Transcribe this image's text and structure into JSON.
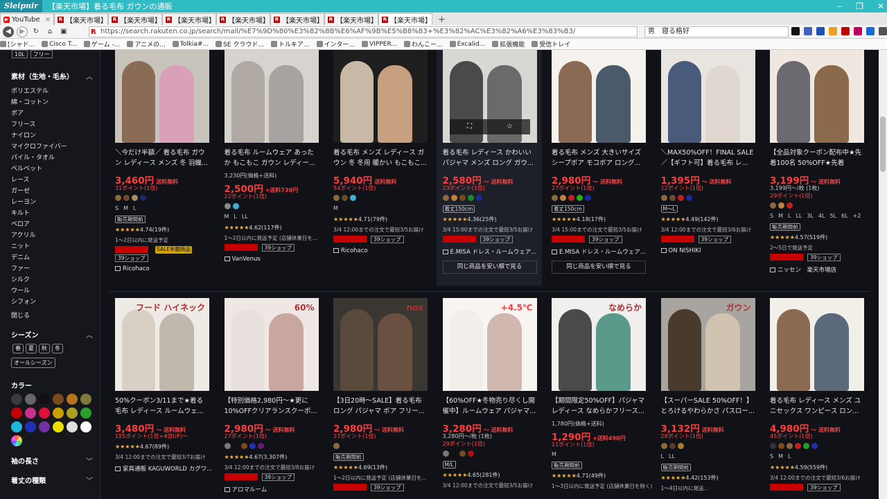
{
  "window": {
    "brand": "Sleipnir",
    "title": "【楽天市場】着る毛布 ガウンの通販",
    "controls": [
      "‒",
      "❐",
      "✕"
    ]
  },
  "tabs": [
    {
      "label": "YouTube",
      "fav": "yt"
    },
    {
      "label": "【楽天市場】着る...",
      "fav": "r"
    },
    {
      "label": "【楽天市場】着る...",
      "fav": "r"
    },
    {
      "label": "【楽天市場】着る...",
      "fav": "r"
    },
    {
      "label": "【楽天市場】着る...",
      "fav": "r"
    },
    {
      "label": "【楽天市場】[10...",
      "fav": "r"
    },
    {
      "label": "【楽天市場】[10...",
      "fav": "r"
    },
    {
      "label": "【楽天市場】着る...",
      "fav": "r",
      "active": true
    }
  ],
  "address": {
    "url": "https://search.rakuten.co.jp/search/mall/%E7%9D%80%E3%82%8B%E6%AF%9B%E5%B8%83+%E3%82%AC%E3%82%A6%E3%83%B3/",
    "search_value": "男　寝る格好"
  },
  "bookmarks": [
    "[シャド...",
    "Cisco T...",
    "ゲーム -...",
    "アニメの...",
    "Tolkia#...",
    "SE クラウド...",
    "トルキア...",
    "インター...",
    "VIPPER...",
    "わんこー...",
    "Excalid...",
    "拡張機能",
    "受信トレイ"
  ],
  "sidebar": {
    "sizes": [
      "10L",
      "フリー"
    ],
    "material_header": "素材（生地・毛糸）",
    "materials": [
      "ポリエステル",
      "綿・コットン",
      "ボア",
      "フリース",
      "ナイロン",
      "マイクロファイバー",
      "パイル・タオル",
      "ベルベット",
      "レース",
      "ガーゼ",
      "レーヨン",
      "キルト",
      "ベロア",
      "アクリル",
      "ニット",
      "デニム",
      "ファー",
      "シルク",
      "ウール",
      "シフォン"
    ],
    "close": "閉じる",
    "season_header": "シーズン",
    "seasons": [
      "春",
      "夏",
      "秋",
      "冬"
    ],
    "all_season": "オールシーズン",
    "color_header": "カラー",
    "colors": [
      "#3a3a3a",
      "#666666",
      "#111111",
      "#7a4a1a",
      "#b8741a",
      "#7d7a3a",
      "#c40000",
      "#c8308a",
      "#e0103a",
      "#c9a000",
      "#a8a020",
      "#2aa02a",
      "#1fb5d8",
      "#2030b0",
      "#7030a0",
      "#e8e000",
      "#e0e0e0",
      "#ffffff"
    ],
    "sleeve_header": "袖の長さ",
    "length_header": "着丈の種類"
  },
  "row1": [
    {
      "name": "＼今だけ半額／ 着る毛布 ガウン レディース メンズ 冬 羽織...",
      "price": "3,460円",
      "price_note": "送料無料",
      "points": "31ポイント(1倍)",
      "dots": [
        "#8a6a3a",
        "#6a4a2a",
        "#a09060",
        "#1a2a6a"
      ],
      "sizes": [
        "S",
        "M",
        "L"
      ],
      "tag": "販売期間前",
      "rating": "4.74",
      "reviews": "(19件)",
      "ship": "1〜2日以内に発送予定",
      "redtag": "SALE半額商品",
      "shop39": "39ショップ",
      "store": "Ricohaco"
    },
    {
      "name": "着る毛布 ルームウェア あったか もこもこ ガウン レディー...",
      "subprice": "3,230円(価格+送料)",
      "price": "2,500円",
      "price_note": "+送料730円",
      "points": "22ポイント(1倍)",
      "dots": [
        "#888888",
        "#40b0d0"
      ],
      "sizes": [
        "M",
        "L",
        "LL"
      ],
      "rating": "4.62",
      "reviews": "(117件)",
      "ship": "1〜2日以内に発送予定 (店舗休業日を...",
      "shop39": "39ショップ",
      "store": "VanVenus"
    },
    {
      "name": "着る毛布 メンズ レディース ガウン 冬 冬用 暖かい もこもこ...",
      "price": "5,940円",
      "price_note": "送料無料",
      "points": "54ポイント(1倍)",
      "dots": [
        "#8a6a3a",
        "#6a4a2a",
        "#40b0d0"
      ],
      "sizes": [
        "M"
      ],
      "rating": "4.71",
      "reviews": "(79件)",
      "ship": "3/4 12:00までの注文で最短3/5お届け",
      "shop39": "39ショップ",
      "store": "Ricohaco"
    },
    {
      "name": "着る毛布 レディース かわいい パジャマ メンズ ロング ガウ...",
      "price": "2,580円",
      "price_note": "〜 送料無料",
      "points": "23ポイント(1倍)",
      "dots": [
        "#8a6a3a",
        "#c08040",
        "#7a4a1a",
        "#1a8a2a",
        "#1a2a9a"
      ],
      "tag": "着丈150cm",
      "rating": "4.36",
      "reviews": "(25件)",
      "ship": "3/4 15:00までの注文で最短3/5お届け",
      "shop39": "39ショップ",
      "store": "E.MISA ドレス・ルームウェア...",
      "same": "同じ商品を安い順で見る",
      "thumb_overlay": [
        "⛶",
        "☆"
      ]
    },
    {
      "name": "着る毛布 メンズ 大きいサイズ シープボア モコボア ロング...",
      "price": "2,980円",
      "price_note": "〜 送料無料",
      "points": "27ポイント(1倍)",
      "dots": [
        "#8a6a3a",
        "#c08040",
        "#c02020",
        "#20b020",
        "#1a2a9a"
      ],
      "tag": "着丈150cm",
      "rating": "4.18",
      "reviews": "(17件)",
      "ship": "3/4 15:00までの注文で最短3/5お届け",
      "shop39": "39ショップ",
      "store": "E.MISA ドレス・ルームウェア...",
      "same": "同じ商品を安い順で見る"
    },
    {
      "name": "＼MAX50%OFF！FINAL SALE／【ギフト可】着る毛布 レ...",
      "price": "1,395円",
      "price_note": "〜 送料無料",
      "points": "12ポイント(1倍)",
      "dots": [
        "#8a6a3a",
        "#6a4a2a",
        "#c02020",
        "#1a2a9a"
      ],
      "tag": "M〜L",
      "rating": "4.49",
      "reviews": "(142件)",
      "ship": "3/4 12:00までの注文で最短3/6お届け",
      "shop39": "39ショップ",
      "store": "ON NISHIKI"
    },
    {
      "name": "【全品対象クーポン配布中★先着100名 50%OFF★先着3,00...",
      "price": "3,199円",
      "price_note": "〜 送料無料",
      "subprice2": "3,199円〜/枚 (1枚)",
      "points": "29ポイント(1倍)",
      "dots": [
        "#8a6a3a",
        "#c08040",
        "#c02020"
      ],
      "sizes": [
        "S",
        "M",
        "L",
        "LL",
        "3L",
        "4L",
        "5L",
        "6L",
        "+2"
      ],
      "tag": "販売期間前",
      "rating": "4.57",
      "reviews": "(519件)",
      "ship": "2〜5日で発送予定",
      "shop39": "39ショップ",
      "store": "ニッセン　楽天市場店"
    }
  ],
  "row2": [
    {
      "name": "50%クーポン3/11まで★着る毛布 レディース ルームウェ...",
      "price": "3,480円",
      "price_note": "〜 送料無料",
      "points": "155ポイント(1倍+4倍UP)〜",
      "rating": "4.67",
      "reviews": "(89件)",
      "ship": "3/4 12:00までの注文で最短3/7お届け",
      "store": "家具通販 KAGUWORLD カグワ...",
      "thumb_text": "フード\nハイネック"
    },
    {
      "name": "【特別価格2,980円〜★更に10%OFFクリアランスクーポ...",
      "price": "2,980円",
      "price_note": "〜 送料無料",
      "points": "27ポイント(1倍)",
      "dots": [
        "#7a7a7a",
        "#111111",
        "#7a4a1a",
        "#2030b0",
        "#6a1a6a"
      ],
      "rating": "4.67",
      "reviews": "(3,307件)",
      "ship": "3/4 12:00までの注文で最短3/8お届け",
      "shop39": "39ショップ",
      "store": "アロマルーム",
      "thumb_text": "60%"
    },
    {
      "name": "【3日20時〜SALE】着る毛布 ロング パジャマ ボア フリー...",
      "price": "2,980円",
      "price_note": "〜 送料無料",
      "points": "27ポイント(1倍)",
      "dots": [
        "#8a6a3a"
      ],
      "tag": "販売期間前",
      "rating": "4.69",
      "reviews": "(13件)",
      "ship": "1〜2日以内に発送予定 (店舗休業日を...",
      "shop39": "39ショップ",
      "thumb_text": "nox"
    },
    {
      "name": "【60%OFF★冬物売り尽くし開催中】ルームウェア パジャマ...",
      "price": "3,280円",
      "price_note": "〜 送料無料",
      "subprice2": "3,280円〜/枚 (1枚)",
      "points": "29ポイント(1倍)",
      "dots": [
        "#777777",
        "#111111",
        "#7a4a1a",
        "#b01010"
      ],
      "tag": "M/L",
      "rating": "4.65",
      "reviews": "(281件)",
      "ship": "3/4 12:00までの注文で最短3/5お届け",
      "thumb_text": "+4.5℃"
    },
    {
      "name": "【期間限定50%OFF】パジャマ レディース なめらかフリース...",
      "subprice": "1,780円(価格+送料)",
      "price": "1,290円",
      "price_note": "+送料490円",
      "points": "11ポイント(1倍)",
      "sizes": [
        "M"
      ],
      "tag": "販売期間前",
      "rating": "4.71",
      "reviews": "(49件)",
      "ship": "1〜3日以内に発送予定 (店舗休業日を除く)",
      "thumb_text": "なめらか"
    },
    {
      "name": "【スーパーSALE 50%OFF！】とろけるやわらかさ パスロー...",
      "price": "3,132円",
      "price_note": "送料無料",
      "points": "28ポイント(1倍)",
      "dots": [
        "#8a6a3a",
        "#5a3a2a",
        "#a08030"
      ],
      "sizes": [
        "L",
        "LL"
      ],
      "tag": "販売期間前",
      "rating": "4.42",
      "reviews": "(153件)",
      "ship": "1〜4日以内に発送...",
      "thumb_text": "ガウン"
    },
    {
      "name": "着る毛布 レディース メンズ ユニセックス ワンピース ロン...",
      "price": "4,980円",
      "price_note": "〜 送料無料",
      "points": "45ポイント(1倍)",
      "dots": [
        "#333333",
        "#7a4a1a",
        "#8a6a3a",
        "#c02020",
        "#20a020",
        "#2030b0"
      ],
      "sizes": [
        "S",
        "M",
        "L"
      ],
      "rating": "4.59",
      "reviews": "(559件)",
      "ship": "3/4 12:00までの注文で最短3/6お届け",
      "shop39": "39ショップ"
    }
  ]
}
